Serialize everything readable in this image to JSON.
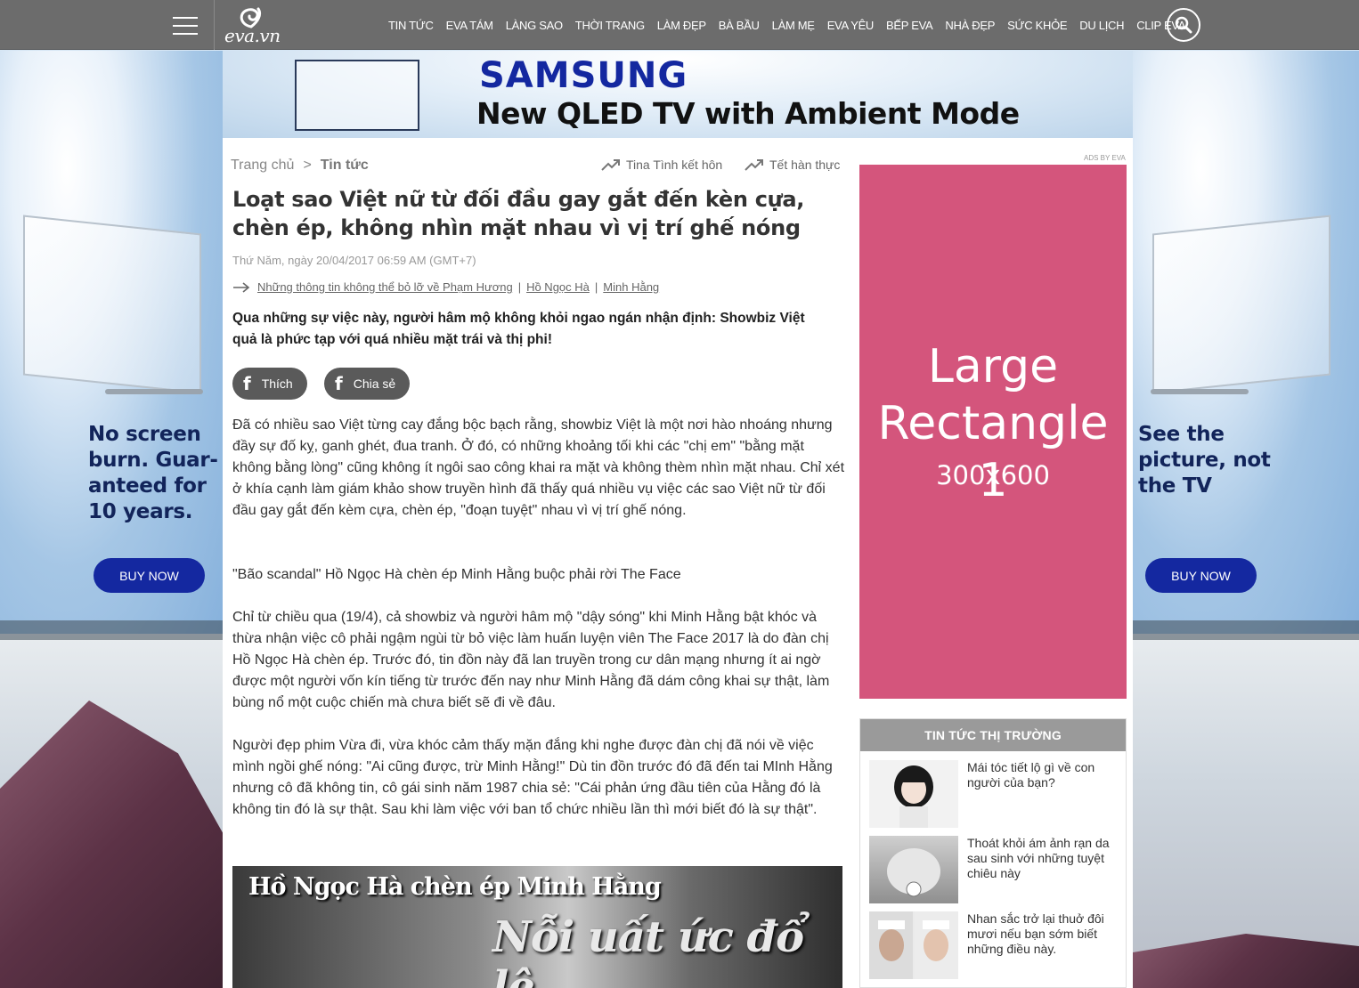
{
  "nav": {
    "menu": [
      "TIN TỨC",
      "EVA TÁM",
      "LÀNG SAO",
      "THỜI TRANG",
      "LÀM ĐẸP",
      "BÀ BẦU",
      "LÀM MẸ",
      "EVA YÊU",
      "BẾP EVA",
      "NHÀ ĐẸP",
      "SỨC KHỎE",
      "DU LỊCH",
      "CLIP EVA"
    ],
    "logo": "eva.vn"
  },
  "ads": {
    "samsung_logo": "SAMSUNG",
    "tagline": "New QLED TV with Ambient Mode",
    "left_copy": [
      "No screen",
      "burn. Guar-",
      "anteed for",
      "10 years."
    ],
    "right_copy": [
      "See the",
      "picture, not",
      "the TV"
    ],
    "buy_now": "BUY NOW",
    "ads_by": "ADS BY EVA",
    "large_rect_title": [
      "Large",
      "Rectangle 1"
    ],
    "large_rect_size": "300x600"
  },
  "breadcrumb": {
    "home": "Trang chủ",
    "separator": ">",
    "current": "Tin tức"
  },
  "trending": [
    "Tina Tình kết hôn",
    "Tết hàn thực"
  ],
  "article": {
    "title": "Loạt sao Việt nữ từ đối đầu gay gắt đến kèn cựa, chèn ép, không nhìn mặt nhau vì vị trí ghế nóng",
    "date": "Thứ Năm, ngày 20/04/2017 06:59 AM (GMT+7)",
    "related": [
      "Những thông tin không thể bỏ lỡ về Phạm Hương",
      "Hồ Ngọc Hà",
      "Minh Hằng"
    ],
    "sapo": "Qua những sự việc này, người hâm mộ không khỏi ngao ngán nhận định: Showbiz Việt quả là phức tạp với quá nhiều mặt trái và thị phi!",
    "like": "Thích",
    "share": "Chia sẻ",
    "paragraphs": [
      "Đã có nhiều sao Việt từng cay đắng bộc bạch rằng, showbiz Việt là một nơi hào nhoáng nhưng đầy sự đố kỵ, ganh ghét, đua tranh. Ở đó, có những khoảng tối khi các \"chị em\" \"bằng mặt không bằng lòng\" cũng không ít ngôi sao công khai ra mặt và không thèm nhìn mặt nhau. Chỉ xét ở khía cạnh làm giám khảo show truyền hình đã thấy quá nhiều vụ việc các sao Việt nữ từ đối đầu gay gắt đến kèm cựa, chèn ép, \"đoạn tuyệt\" nhau vì vị trí ghế nóng.",
      "\"Bão scandal\" Hồ Ngọc Hà chèn ép Minh Hằng buộc phải rời The Face",
      "Chỉ từ chiều qua (19/4), cả showbiz và người hâm mộ \"dậy sóng\" khi Minh Hằng bật khóc và thừa nhận việc cô phải ngậm ngùi từ bỏ việc làm huấn luyện viên The Face 2017 là do đàn chị Hồ Ngọc Hà chèn ép. Trước đó, tin đồn này đã lan truyền trong cư dân mạng nhưng ít ai ngờ được một người vốn kín tiếng từ trước đến nay như Minh Hằng đã dám công khai sự thật, làm bùng nổ một cuộc chiến mà chưa biết sẽ đi về đâu.",
      "Người đẹp phim Vừa đi, vừa khóc cảm thấy mặn đắng khi nghe được đàn chị đã nói về việc mình ngồi ghế nóng: \"Ai cũng được, trừ Minh Hằng!\" Dù tin đồn trước đó đã đến tai MInh Hằng nhưng cô đã không tin, cô gái sinh năm 1987 chia sẻ: \"Cái phản ứng đầu tiên của Hằng đó là không tin đó là sự thật. Sau khi làm việc với ban tổ chức nhiều lần thì mới biết đó là sự thật\"."
    ],
    "image_caption": "Hồ Ngọc Hà chèn ép Minh Hằng",
    "image_script": "Nỗi uất ức đổ lệ"
  },
  "market": {
    "heading": "TIN TỨC THỊ TRƯỜNG",
    "items": [
      "Mái tóc tiết lộ gì về con người của bạn?",
      "Thoát khỏi ám ảnh rạn da sau sinh với những tuyệt chiêu này",
      "Nhan sắc trở lại thuở đôi mươi nếu bạn sớm biết những điều này."
    ]
  },
  "colors": {
    "nav_bg": "#6c6c6c",
    "samsung_blue": "#1428a0",
    "ad_pink": "#d4557c",
    "market_head": "#9a9a9a"
  }
}
